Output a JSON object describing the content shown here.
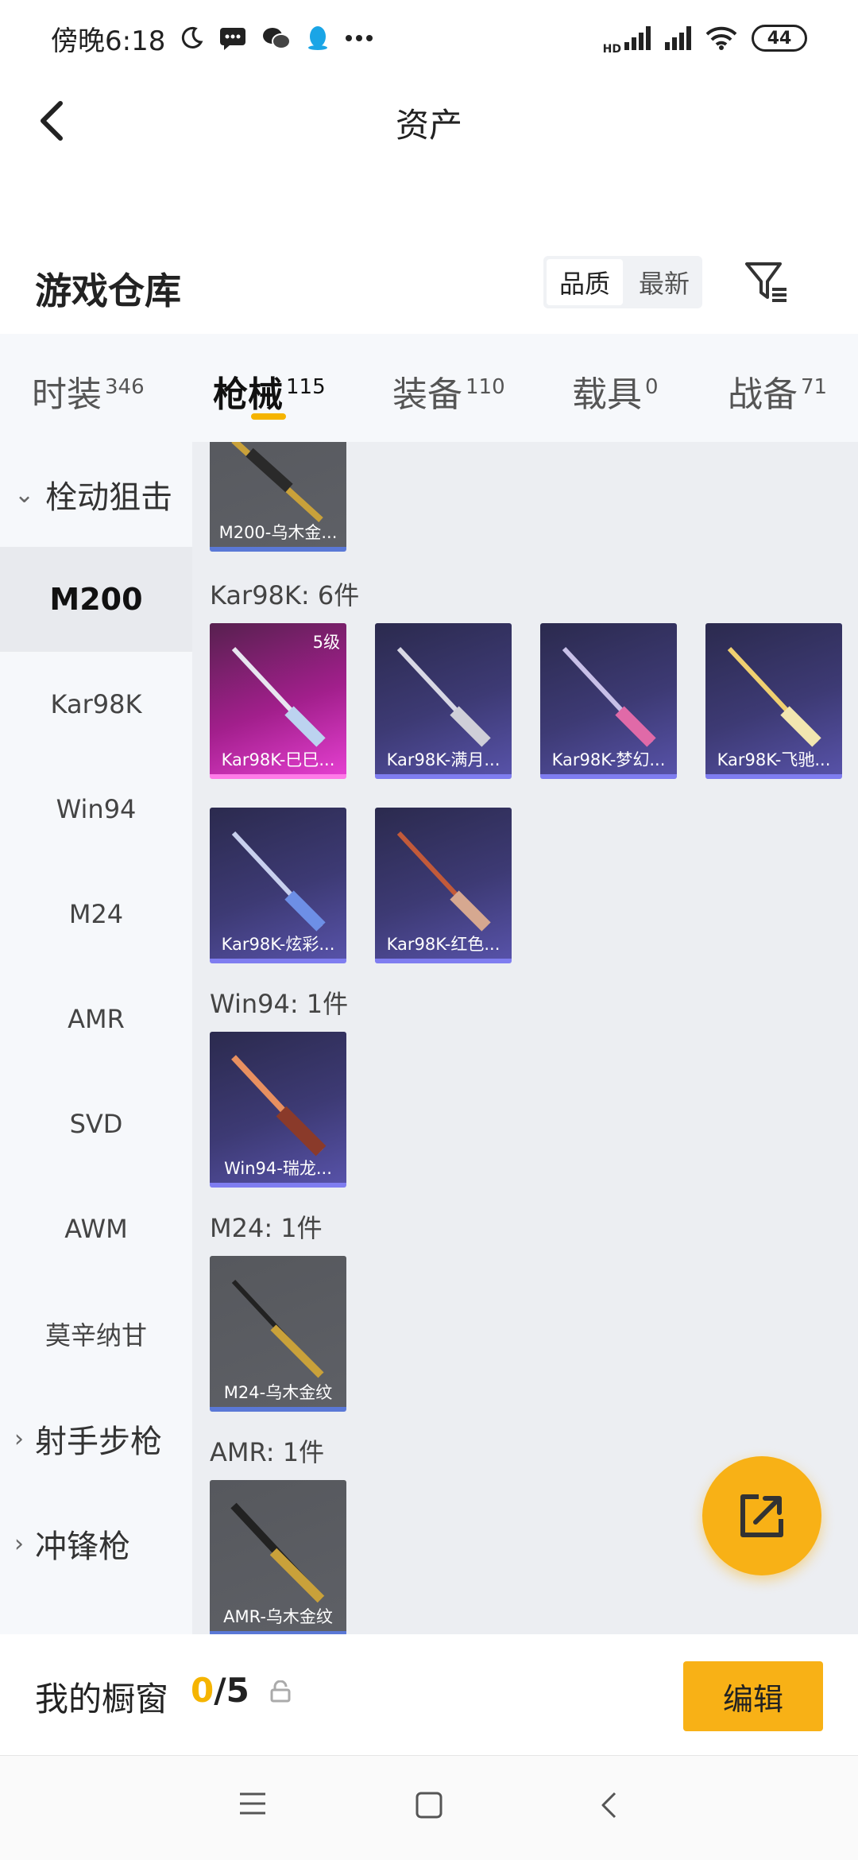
{
  "status_bar": {
    "time": "傍晚6:18",
    "battery": "44",
    "network_label": "HD"
  },
  "header": {
    "title": "资产"
  },
  "warehouse": {
    "title": "游戏仓库",
    "sort_options": [
      "品质",
      "最新"
    ],
    "sort_selected": "品质"
  },
  "category_tabs": [
    {
      "label": "时装",
      "count": "346"
    },
    {
      "label": "枪械",
      "count": "115",
      "active": true
    },
    {
      "label": "装备",
      "count": "110"
    },
    {
      "label": "载具",
      "count": "0"
    },
    {
      "label": "战备",
      "count": "71"
    }
  ],
  "sidebar": {
    "groups": [
      {
        "label": "栓动狙击",
        "expanded": true
      },
      {
        "label": "射手步枪",
        "expanded": false
      },
      {
        "label": "冲锋枪",
        "expanded": false
      }
    ],
    "items": [
      "M200",
      "Kar98K",
      "Win94",
      "M24",
      "AMR",
      "SVD",
      "AWM",
      "莫辛纳甘"
    ],
    "selected": "M200"
  },
  "content": {
    "top_card": "M200-乌木金...",
    "sections": [
      {
        "label": "Kar98K: 6件",
        "cards": [
          {
            "name": "Kar98K-巳巳...",
            "rarity": "pink",
            "level": "5级"
          },
          {
            "name": "Kar98K-满月...",
            "rarity": "purple"
          },
          {
            "name": "Kar98K-梦幻...",
            "rarity": "purple"
          },
          {
            "name": "Kar98K-飞驰...",
            "rarity": "purple"
          },
          {
            "name": "Kar98K-炫彩...",
            "rarity": "purple"
          },
          {
            "name": "Kar98K-红色...",
            "rarity": "purple"
          }
        ]
      },
      {
        "label": "Win94: 1件",
        "cards": [
          {
            "name": "Win94-瑞龙...",
            "rarity": "purple"
          }
        ]
      },
      {
        "label": "M24: 1件",
        "cards": [
          {
            "name": "M24-乌木金纹",
            "rarity": "gray"
          }
        ]
      },
      {
        "label": "AMR: 1件",
        "cards": [
          {
            "name": "AMR-乌木金纹",
            "rarity": "gray"
          }
        ]
      }
    ]
  },
  "showcase": {
    "title": "我的橱窗",
    "count_current": "0",
    "count_sep_total": "/5",
    "edit_label": "编辑"
  },
  "colors": {
    "accent": "#f8b116",
    "tab_underline": "#f5b400",
    "rarity_purple": "#3d3a74",
    "rarity_pink": "#a21f8c"
  }
}
